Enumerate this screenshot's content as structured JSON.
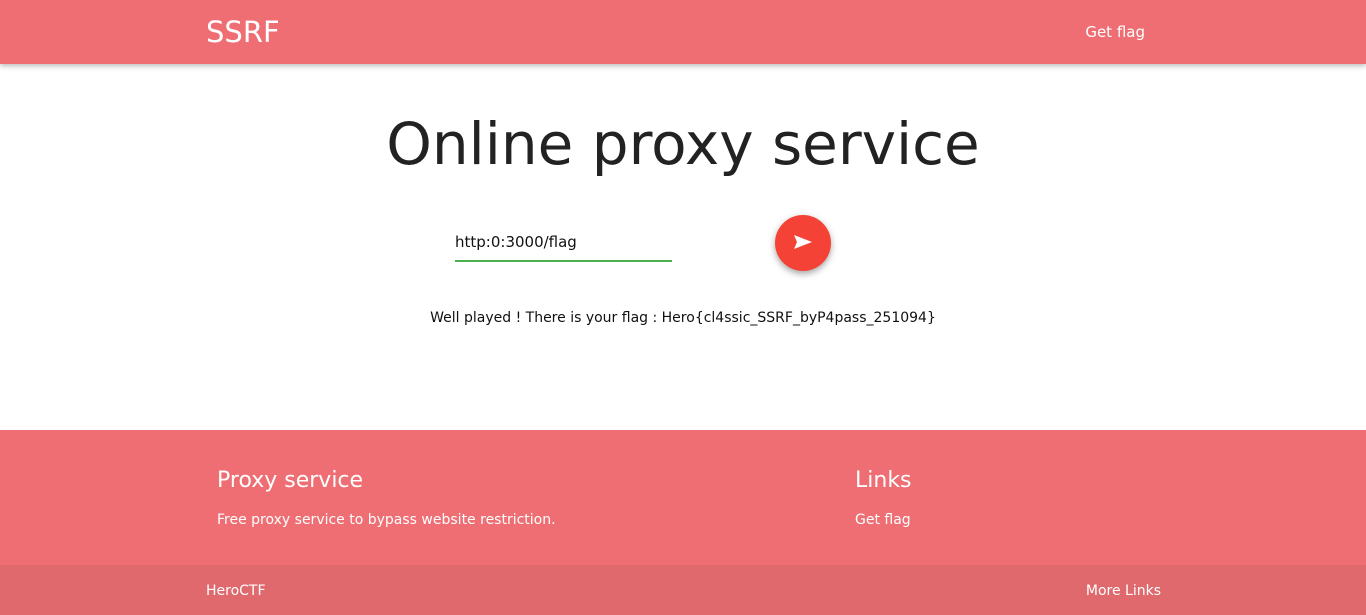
{
  "nav": {
    "brand": "SSRF",
    "link": "Get flag"
  },
  "main": {
    "title": "Online proxy service",
    "url_value": "http:0:3000/flag",
    "send_icon": "send-icon",
    "result_text": "Well played ! There is your flag : Hero{cl4ssic_SSRF_byP4pass_251094}"
  },
  "footer": {
    "col1_title": "Proxy service",
    "col1_text": "Free proxy service to bypass website restriction.",
    "col2_title": "Links",
    "col2_link": "Get flag"
  },
  "copyright": {
    "text": "HeroCTF",
    "more_link": "More Links"
  },
  "colors": {
    "primary": "#ee6e73",
    "button": "#f44336",
    "input_underline": "#4caf50"
  }
}
